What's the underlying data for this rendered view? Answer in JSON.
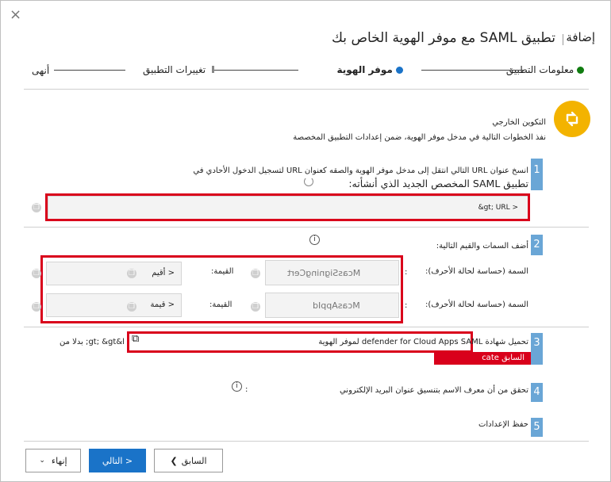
{
  "dialog": {
    "close_glyph": "×",
    "title": "تطبيق SAML مع موفر الهوية الخاص بك",
    "add_label": "إضافة"
  },
  "stepper": {
    "steps": [
      {
        "label": "معلومات التطبيق",
        "state": "done"
      },
      {
        "label": "موفر الهوية",
        "state": "current"
      },
      {
        "label": "تغييرات التطبيق",
        "state": "pending"
      },
      {
        "label": "أنهى",
        "state": "pending"
      }
    ],
    "done_color": "#107c10",
    "current_color": "#1a73c8"
  },
  "section": {
    "heading": "التكوين الخارجي",
    "description": "نفذ الخطوات التالية في مدخل موفر الهوية، ضمن إعدادات التطبيق المخصصة"
  },
  "steps": {
    "s1": {
      "number": "1",
      "line1": "انسخ عنوان URL التالي انتقل إلى مدخل موفر الهوية والصقه كعنوان URL لتسجيل الدخول الأحادي في",
      "line2": "تطبيق SAML المخصص الجديد الذي أنشأته:",
      "url_value": "< gt; URL&"
    },
    "s2": {
      "number": "2",
      "label": "أضف السمات والقيم التالية:",
      "rows": [
        {
          "attr_label": "السمة (حساسة لحالة الأحرف):",
          "attr_value": "McasSigningCert",
          "value_label": "القيمة:",
          "value_value": "< أقيم"
        },
        {
          "attr_label": "السمة (حساسة لحالة الأحرف):",
          "attr_value": "McasAppId",
          "value_label": "القيمة:",
          "value_value": "< قيمة"
        }
      ]
    },
    "s3": {
      "number": "3",
      "text": "تحميل شهادة defender for Cloud Apps SAML لموفر الهوية",
      "suffix": "gt; &gt&l; بدلا من",
      "extra": "السابق cate"
    },
    "s4": {
      "number": "4",
      "text": "تحقق من أن معرف الاسم بتنسيق عنوان البريد الإلكتروني"
    },
    "s5": {
      "number": "5",
      "text": "حفظ الإعدادات"
    }
  },
  "footer": {
    "back_label": "السابق",
    "next_label": "التالي >",
    "finish_label": "إنهاء"
  },
  "colors": {
    "accent": "#1a73c8",
    "highlight": "#d9001b",
    "badge": "#f3b300",
    "step_number_bg": "#6aa6d6"
  }
}
